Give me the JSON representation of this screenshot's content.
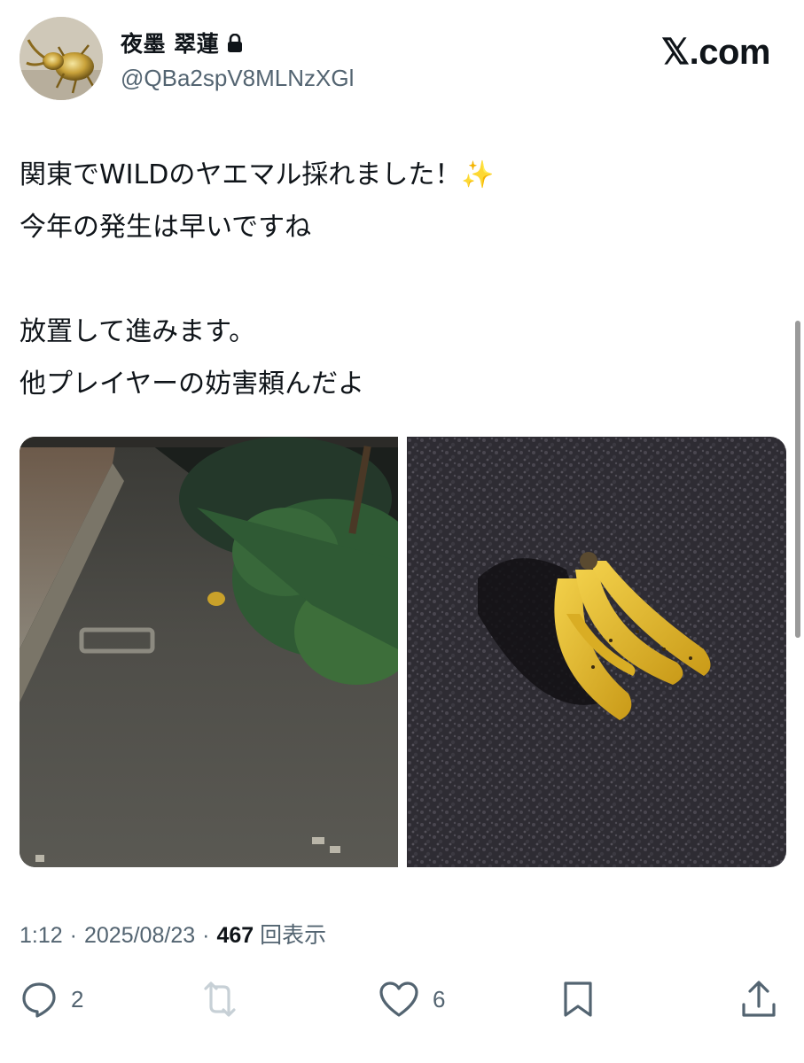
{
  "author": {
    "display_name": "夜墨 翠蓮",
    "handle": "@QBa2spV8MLNzXGl",
    "avatar_icon": "golden-stag-beetle-avatar",
    "protected_icon": "lock-icon"
  },
  "brand": {
    "label": "𝕏.com",
    "icon": "x-logo"
  },
  "tweet": {
    "text": "関東でWILDのヤエマル採れました！✨\n今年の発生は早いですね\n\n放置して進みます。\n他プレイヤーの妨害頼んだよ"
  },
  "media": [
    {
      "icon": "night-sidewalk-photo-with-banana"
    },
    {
      "icon": "banana-bunch-on-asphalt-photo"
    }
  ],
  "meta": {
    "time": "1:12",
    "separator_1": "·",
    "date": "2025/08/23",
    "separator_2": "·",
    "views_count": "467",
    "views_label": "回表示"
  },
  "actions": {
    "reply_count": "2",
    "like_count": "6",
    "icons": [
      "reply-icon",
      "retweet-icon",
      "like-icon",
      "bookmark-icon",
      "share-icon"
    ]
  },
  "colors": {
    "text_primary": "#0f1419",
    "text_secondary": "#536471",
    "retweet_disabled": "#c7d0d6"
  }
}
